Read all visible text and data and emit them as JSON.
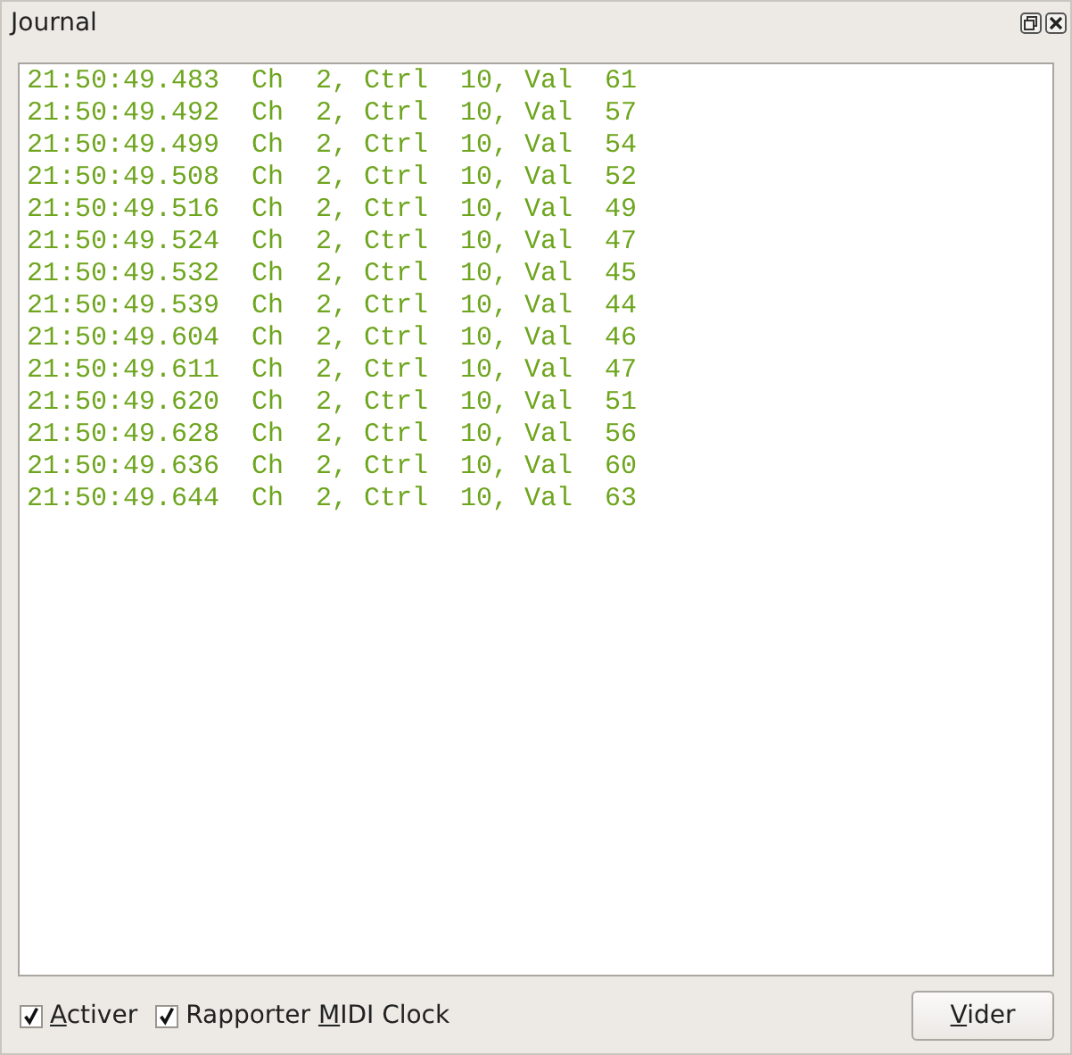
{
  "window": {
    "title": "Journal"
  },
  "log": {
    "lines": [
      "21:50:49.483  Ch  2, Ctrl  10, Val  61",
      "21:50:49.492  Ch  2, Ctrl  10, Val  57",
      "21:50:49.499  Ch  2, Ctrl  10, Val  54",
      "21:50:49.508  Ch  2, Ctrl  10, Val  52",
      "21:50:49.516  Ch  2, Ctrl  10, Val  49",
      "21:50:49.524  Ch  2, Ctrl  10, Val  47",
      "21:50:49.532  Ch  2, Ctrl  10, Val  45",
      "21:50:49.539  Ch  2, Ctrl  10, Val  44",
      "21:50:49.604  Ch  2, Ctrl  10, Val  46",
      "21:50:49.611  Ch  2, Ctrl  10, Val  47",
      "21:50:49.620  Ch  2, Ctrl  10, Val  51",
      "21:50:49.628  Ch  2, Ctrl  10, Val  56",
      "21:50:49.636  Ch  2, Ctrl  10, Val  60",
      "21:50:49.644  Ch  2, Ctrl  10, Val  63"
    ]
  },
  "options": [
    {
      "label": {
        "key": "A",
        "post": "ctiver"
      },
      "checked": true
    },
    {
      "label": {
        "pre": "Rapporter ",
        "key": "M",
        "post": "IDI Clock"
      },
      "checked": true
    }
  ],
  "button": {
    "key": "V",
    "post": "ider"
  }
}
